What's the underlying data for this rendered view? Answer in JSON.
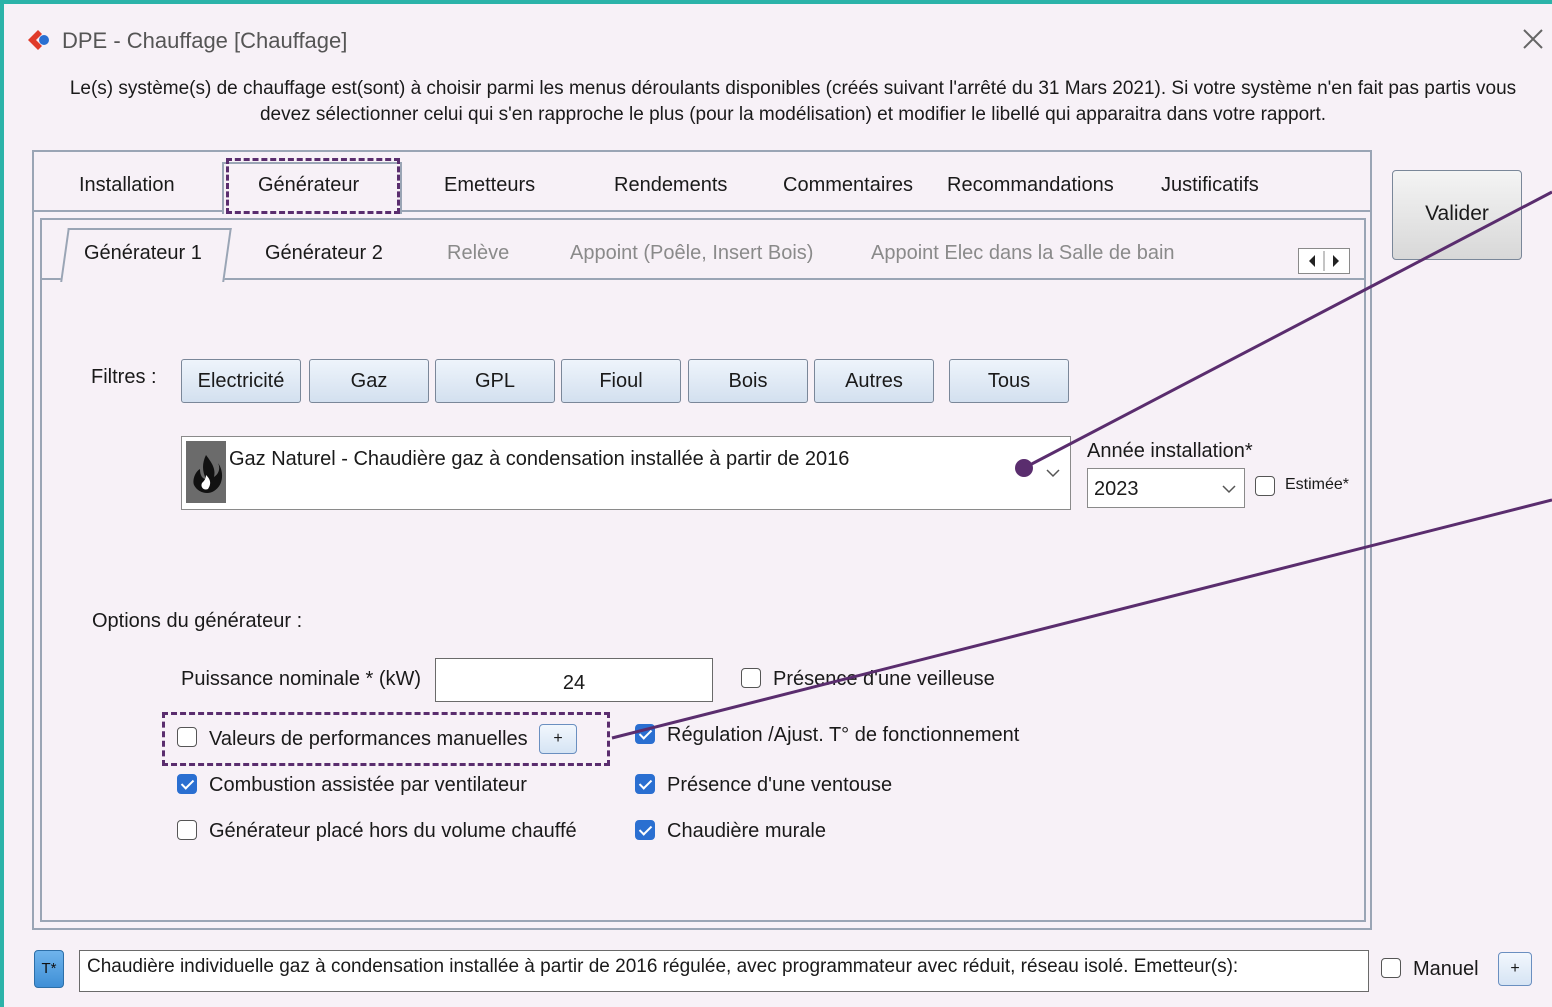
{
  "window": {
    "title": "DPE - Chauffage [Chauffage]"
  },
  "intro": {
    "line1": "Le(s) système(s) de chauffage est(sont) à choisir parmi les menus déroulants disponibles (créés suivant l'arrêté du 31 Mars 2021). Si votre système n'en fait pas partis vous",
    "line2": "devez sélectionner celui qui s'en rapproche le plus (pour la modélisation) et modifier le libellé qui apparaitra dans votre rapport."
  },
  "tabs": [
    {
      "label": "Installation"
    },
    {
      "label": "Générateur"
    },
    {
      "label": "Emetteurs"
    },
    {
      "label": "Rendements"
    },
    {
      "label": "Commentaires"
    },
    {
      "label": "Recommandations"
    },
    {
      "label": "Justificatifs"
    }
  ],
  "valider_label": "Valider",
  "subtabs": [
    {
      "label": "Générateur 1"
    },
    {
      "label": "Générateur 2"
    },
    {
      "label": "Relève"
    },
    {
      "label": "Appoint (Poêle, Insert Bois)"
    },
    {
      "label": "Appoint Elec dans la Salle de bain"
    }
  ],
  "filters": {
    "label": "Filtres :",
    "buttons": [
      "Electricité",
      "Gaz",
      "GPL",
      "Fioul",
      "Bois",
      "Autres",
      "Tous"
    ]
  },
  "generator_select": {
    "value": "Gaz Naturel - Chaudière gaz à condensation installée à partir de 2016"
  },
  "annee": {
    "label": "Année installation*",
    "value": "2023",
    "estimee_label": "Estimée*"
  },
  "options": {
    "title": "Options du générateur :",
    "puissance_label": "Puissance nominale * (kW)",
    "puissance_value": "24",
    "veilleuse": {
      "label": "Présence d'une veilleuse",
      "checked": false
    },
    "valeurs_manuelles": {
      "label": "Valeurs de performances manuelles",
      "checked": false
    },
    "plus": "+",
    "regulation": {
      "label": "Régulation /Ajust. T° de fonctionnement",
      "checked": true
    },
    "combustion": {
      "label": "Combustion assistée par ventilateur",
      "checked": true
    },
    "ventouse": {
      "label": "Présence d'une ventouse",
      "checked": true
    },
    "hors_volume": {
      "label": "Générateur placé hors du volume chauffé",
      "checked": false
    },
    "murale": {
      "label": "Chaudière murale",
      "checked": true
    }
  },
  "footer": {
    "t_button": "T*",
    "libelle": "Chaudière individuelle gaz à condensation installée à partir de 2016 régulée, avec programmateur avec réduit, réseau isolé. Emetteur(s):",
    "manuel_label": "Manuel",
    "plus": "+"
  },
  "colors": {
    "accent_border": "#2bb3a9",
    "annotation": "#5a2d6e",
    "check": "#2a6fd1"
  }
}
